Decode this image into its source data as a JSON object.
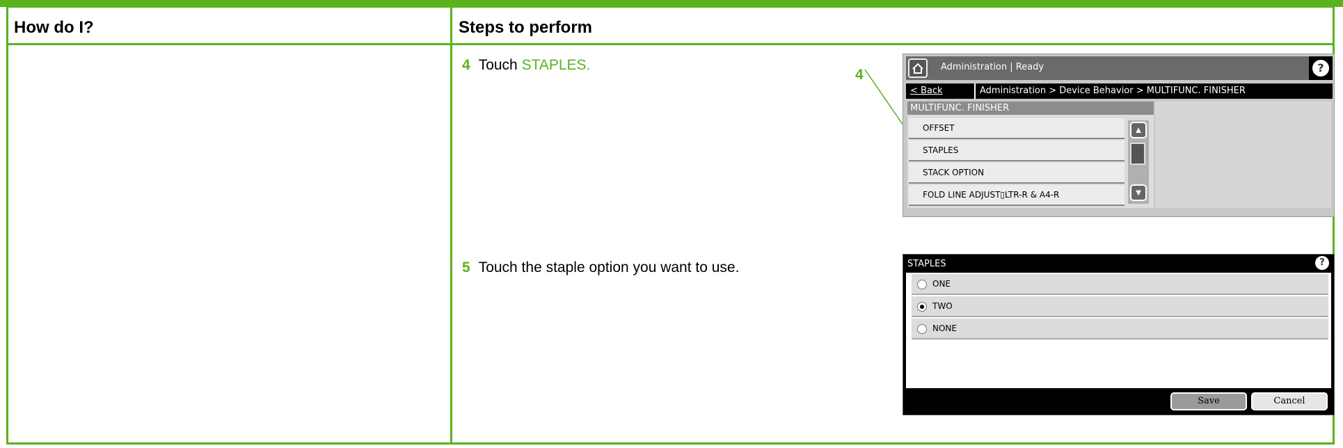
{
  "table": {
    "col1_header": "How do I?",
    "col2_header": "Steps to perform"
  },
  "steps": [
    {
      "number": "4",
      "text": "Touch ",
      "highlight": "STAPLES."
    },
    {
      "number": "5",
      "text": "Touch the staple option you want to use."
    }
  ],
  "callout": "4",
  "colors": {
    "accent": "#5ab21e"
  },
  "panel1": {
    "title": "Administration | Ready",
    "back_label": "< Back",
    "breadcrumb": "Administration > Device Behavior > MULTIFUNC. FINISHER",
    "list_header": "MULTIFUNC. FINISHER",
    "items": [
      "OFFSET",
      "STAPLES",
      "STACK OPTION",
      "FOLD LINE ADJUST▯LTR-R & A4-R"
    ],
    "help": "?"
  },
  "panel2": {
    "title": "STAPLES",
    "help": "?",
    "options": [
      {
        "label": "ONE",
        "selected": false
      },
      {
        "label": "TWO",
        "selected": true
      },
      {
        "label": "NONE",
        "selected": false
      }
    ],
    "save_label": "Save",
    "cancel_label": "Cancel"
  }
}
